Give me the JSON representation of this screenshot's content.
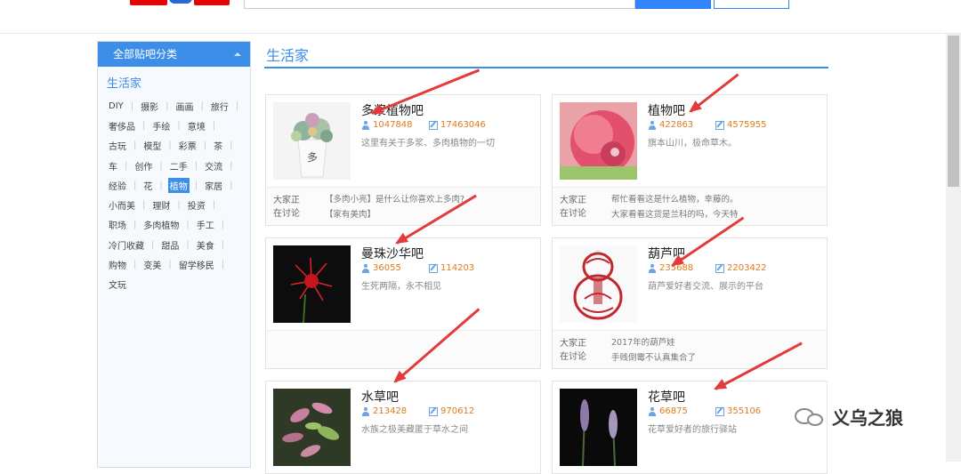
{
  "header": {
    "search_placeholder": ""
  },
  "sidebar": {
    "title": "全部贴吧分类",
    "category": "生活家",
    "rows": [
      [
        "DIY",
        "摄影",
        "画画",
        "旅行"
      ],
      [
        "奢侈品",
        "手绘",
        "意境"
      ],
      [
        "古玩",
        "模型",
        "彩票",
        "茶"
      ],
      [
        "车",
        "创作",
        "二手",
        "交流"
      ],
      [
        "经验",
        "花",
        "植物",
        "家居"
      ],
      [
        "小而美",
        "理财",
        "投资"
      ],
      [
        "职场",
        "多肉植物",
        "手工"
      ],
      [
        "冷门收藏",
        "甜品",
        "美食"
      ],
      [
        "购物",
        "变美",
        "留学移民"
      ],
      [
        "文玩"
      ]
    ],
    "active_tag": "植物"
  },
  "main": {
    "title": "生活家",
    "cards": [
      {
        "name": "多浆植物吧",
        "members": "1047848",
        "posts": "17463046",
        "desc": "这里有关于多浆、多肉植物的一切",
        "discuss_label": "大家正在讨论",
        "discuss": [
          "【多肉小亮】是什么让你喜欢上多肉?",
          "【家有美肉】"
        ]
      },
      {
        "name": "植物吧",
        "members": "422863",
        "posts": "4575955",
        "desc": "旗本山川，极命草木。",
        "discuss_label": "大家正在讨论",
        "discuss": [
          "帮忙看看这是什么植物，幸藤的。",
          "大家看看这货是兰科的吗，今天特"
        ]
      },
      {
        "name": "曼珠沙华吧",
        "members": "36055",
        "posts": "114203",
        "desc": "生死两隔，永不相见",
        "discuss_label": "",
        "discuss": []
      },
      {
        "name": "葫芦吧",
        "members": "235688",
        "posts": "2203422",
        "desc": "葫芦爱好者交流、展示的平台",
        "discuss_label": "大家正在讨论",
        "discuss": [
          "2017年的葫芦娃",
          "手贱倒霉不认真集合了"
        ]
      },
      {
        "name": "水草吧",
        "members": "213428",
        "posts": "970612",
        "desc": "水族之极美藏匿于草水之间",
        "discuss_label": "",
        "discuss": []
      },
      {
        "name": "花草吧",
        "members": "66875",
        "posts": "355106",
        "desc": "花草爱好者的旅行驿站",
        "discuss_label": "",
        "discuss": []
      }
    ]
  },
  "watermark": {
    "text": "义乌之狼"
  },
  "colors": {
    "accent": "#3d8ee8",
    "stat": "#e07a1f",
    "annotation": "#e23b3b"
  }
}
